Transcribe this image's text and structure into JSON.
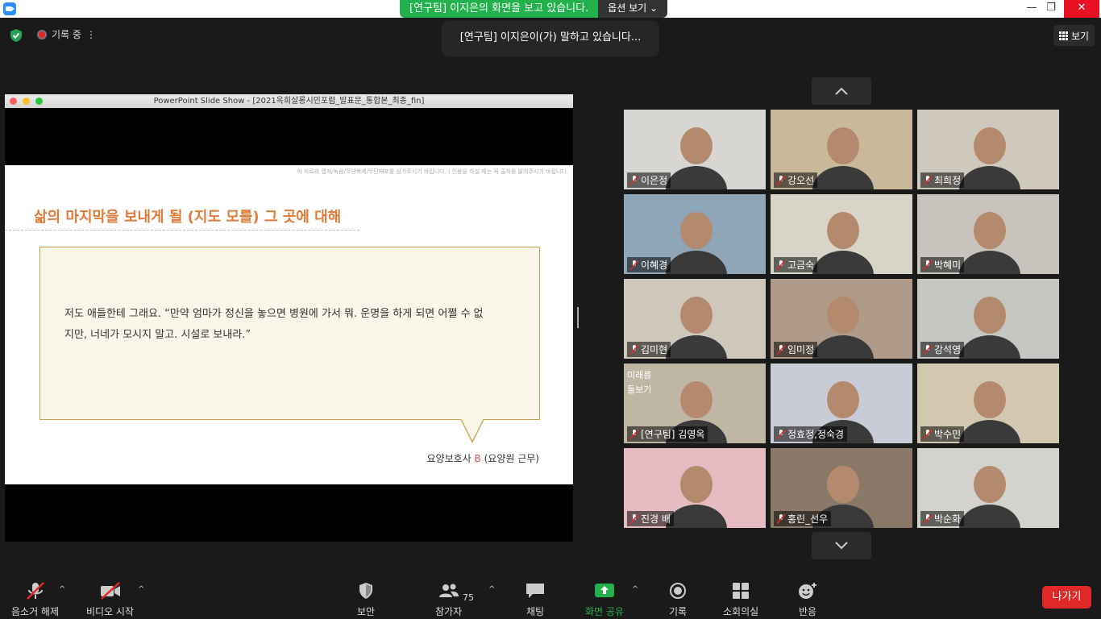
{
  "titlebar": {
    "share_banner": "[연구팀] 이지은의 화면을 보고 있습니다.",
    "view_options": "옵션 보기 ⌄",
    "min": "—",
    "restore": "❐",
    "close": "✕"
  },
  "top": {
    "recording": "기록 중",
    "recording_more": "⋮",
    "speaking": "[연구팀] 이지은이(가) 말하고 있습니다...",
    "view_label": "보기"
  },
  "shared": {
    "window_title": "PowerPoint Slide Show - [2021옥희살롱시민포럼_발표문_통합본_최종_fin]",
    "notice": "이 자료의 캡쳐/녹음/무단복제/무단배포를 삼가주시기 바랍니다. | 인용을 하실 때는 꼭 출처를 밝혀주시기 바랍니다.",
    "heading": "삶의 마지막을 보내게 될 (지도 모를) 그 곳에 대해",
    "quote_line1": "저도 애들한테 그래요. “만약 엄마가 정신을 놓으면 병원에 가서 뭐. 운명을 하게 되면 어쩔 수 없",
    "quote_line2": "지만, 너네가 모시지 말고. 시설로 보내라.”",
    "speaker_prefix": "요양보호사",
    "speaker_code": "B",
    "speaker_suffix": "(요양원 근무)"
  },
  "participants": [
    {
      "name": "이은정",
      "bg": "#d8d6d2"
    },
    {
      "name": "강오선",
      "bg": "#c9b99a"
    },
    {
      "name": "최희정",
      "bg": "#cfc8bc"
    },
    {
      "name": "이혜경",
      "bg": "#8fa6b8"
    },
    {
      "name": "고금숙",
      "bg": "#d8d4c8"
    },
    {
      "name": "박혜미",
      "bg": "#c8c4bd"
    },
    {
      "name": "김미현",
      "bg": "#cfc7ba"
    },
    {
      "name": "임미정",
      "bg": "#b09b8a"
    },
    {
      "name": "강석영",
      "bg": "#c5c7c2"
    },
    {
      "name": "[연구팀] 김영옥",
      "bg": "#bfb6a4"
    },
    {
      "name": "정효정,정숙경",
      "bg": "#c7ccd6"
    },
    {
      "name": "박수민",
      "bg": "#d2c8b0"
    },
    {
      "name": "진경 배",
      "bg": "#e6bcc2"
    },
    {
      "name": "홍린_선우",
      "bg": "#8a7868"
    },
    {
      "name": "박순화",
      "bg": "#d4d2cc"
    }
  ],
  "tile9_overlay": {
    "text1": "미래를",
    "text2": "돌보기"
  },
  "toolbar": {
    "unmute": "음소거 해제",
    "start_video": "비디오 시작",
    "security": "보안",
    "participants": "참가자",
    "participant_count": "75",
    "chat": "채팅",
    "share_screen": "화면 공유",
    "record": "기록",
    "breakout": "소회의실",
    "reactions": "반응",
    "leave": "나가기",
    "caret": "^"
  },
  "colors": {
    "accent_green": "#22b14c",
    "leave_red": "#e02828",
    "heading_orange": "#e07b39"
  }
}
